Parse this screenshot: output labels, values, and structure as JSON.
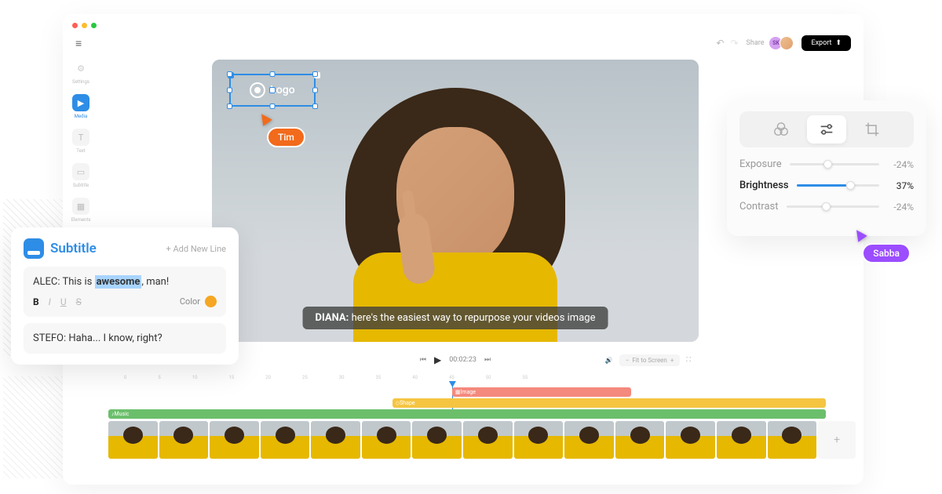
{
  "header": {
    "share_label": "Share",
    "export_label": "Export",
    "avatar_initials": "SK"
  },
  "sidebar": {
    "items": [
      {
        "label": "Settings"
      },
      {
        "label": "Media"
      },
      {
        "label": "Text"
      },
      {
        "label": "Subtitle"
      },
      {
        "label": "Elements"
      }
    ]
  },
  "canvas": {
    "logo_label": "Logo",
    "subtitle_speaker": "DIANA:",
    "subtitle_text": "here's the easiest way to repurpose your videos image"
  },
  "cursors": {
    "tim": "Tim",
    "sabba": "Sabba"
  },
  "subtitle_panel": {
    "title": "Subtitle",
    "add_new": "+ Add New Line",
    "line1_speaker": "ALEC:",
    "line1_before": "This is ",
    "line1_highlight": "awesome",
    "line1_after": ", man!",
    "color_label": "Color",
    "line2_speaker": "STEFO:",
    "line2_text": "Haha... I know, right?"
  },
  "adjust_panel": {
    "rows": [
      {
        "label": "Exposure",
        "value": "-24%",
        "pos": 38
      },
      {
        "label": "Brightness",
        "value": "37%",
        "pos": 60
      },
      {
        "label": "Contrast",
        "value": "-24%",
        "pos": 38
      }
    ]
  },
  "playback": {
    "time": "00:02:23",
    "fit_label": "Fit to Screen"
  },
  "timeline": {
    "marks": [
      "0",
      "5",
      "10",
      "15",
      "20",
      "25",
      "30",
      "35",
      "40",
      "45",
      "50",
      "55"
    ],
    "track_red": "Image",
    "track_yellow": "Shape",
    "track_green": "Music"
  }
}
